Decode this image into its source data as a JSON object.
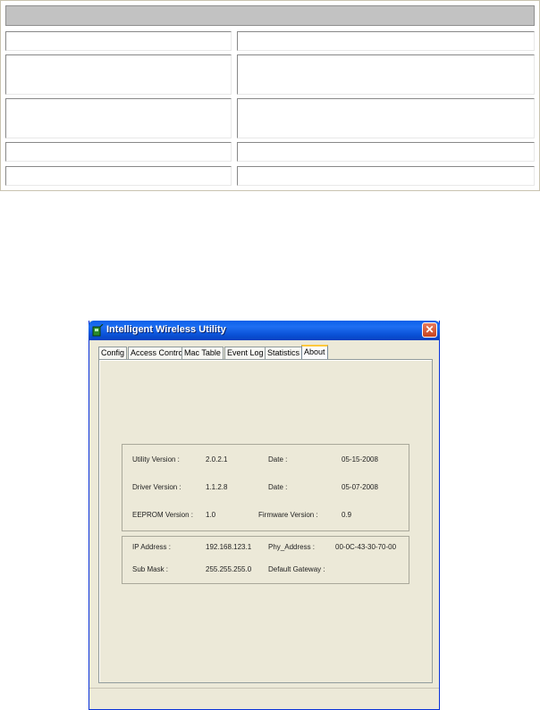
{
  "window": {
    "title": "Intelligent Wireless Utility",
    "close_glyph": "✕"
  },
  "tabs": [
    {
      "label": "Config",
      "active": false
    },
    {
      "label": "Access Control",
      "active": false
    },
    {
      "label": "Mac Table",
      "active": false
    },
    {
      "label": "Event Log",
      "active": false
    },
    {
      "label": "Statistics",
      "active": false
    },
    {
      "label": "About",
      "active": true
    }
  ],
  "about": {
    "versions": {
      "utility_version_label": "Utility Version :",
      "utility_version_value": "2.0.2.1",
      "utility_date_label": "Date :",
      "utility_date_value": "05-15-2008",
      "driver_version_label": "Driver Version :",
      "driver_version_value": "1.1.2.8",
      "driver_date_label": "Date :",
      "driver_date_value": "05-07-2008",
      "eeprom_version_label": "EEPROM Version :",
      "eeprom_version_value": "1.0",
      "firmware_version_label": "Firmware Version :",
      "firmware_version_value": "0.9"
    },
    "network": {
      "ip_address_label": "IP Address :",
      "ip_address_value": "192.168.123.1",
      "phy_address_label": "Phy_Address :",
      "phy_address_value": "00-0C-43-30-70-00",
      "sub_mask_label": "Sub Mask :",
      "sub_mask_value": "255.255.255.0",
      "default_gateway_label": "Default Gateway :"
    }
  },
  "colors": {
    "titlebar": "#0a5fe8",
    "window_face": "#ece9d8",
    "active_tab_highlight": "#ffc83c",
    "close_button": "#d35a35"
  }
}
